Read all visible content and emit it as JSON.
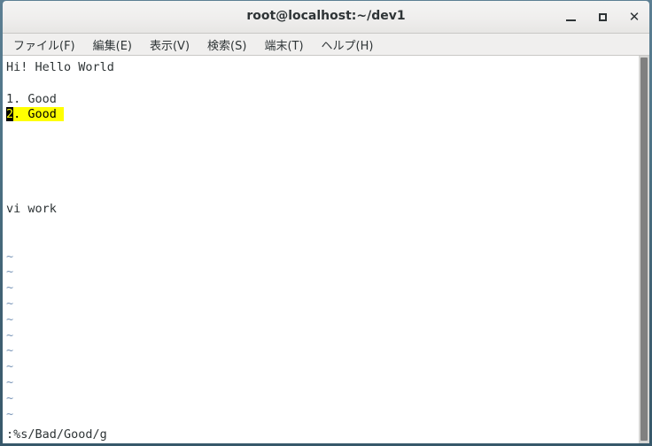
{
  "window": {
    "title": "root@localhost:~/dev1",
    "controls": {
      "minimize": "_",
      "maximize": "□",
      "close": "✕"
    }
  },
  "menubar": {
    "items": [
      {
        "label": "ファイル(F)"
      },
      {
        "label": "編集(E)"
      },
      {
        "label": "表示(V)"
      },
      {
        "label": "検索(S)"
      },
      {
        "label": "端末(T)"
      },
      {
        "label": "ヘルプ(H)"
      }
    ]
  },
  "terminal": {
    "lines": [
      {
        "text": "Hi! Hello World",
        "style": "normal"
      },
      {
        "text": "",
        "style": "normal"
      },
      {
        "text": "1. Good",
        "style": "normal"
      },
      {
        "text": "",
        "style": "highlight"
      },
      {
        "text": "",
        "style": "normal"
      },
      {
        "text": "",
        "style": "normal"
      },
      {
        "text": "",
        "style": "normal"
      },
      {
        "text": "",
        "style": "normal"
      },
      {
        "text": "",
        "style": "normal"
      },
      {
        "text": "vi work",
        "style": "normal"
      },
      {
        "text": "",
        "style": "normal"
      },
      {
        "text": "",
        "style": "normal"
      },
      {
        "text": "~",
        "style": "tilde"
      },
      {
        "text": "~",
        "style": "tilde"
      },
      {
        "text": "~",
        "style": "tilde"
      },
      {
        "text": "~",
        "style": "tilde"
      },
      {
        "text": "~",
        "style": "tilde"
      },
      {
        "text": "~",
        "style": "tilde"
      },
      {
        "text": "~",
        "style": "tilde"
      },
      {
        "text": "~",
        "style": "tilde"
      },
      {
        "text": "~",
        "style": "tilde"
      },
      {
        "text": "~",
        "style": "tilde"
      },
      {
        "text": "~",
        "style": "tilde"
      }
    ],
    "highlighted_line": {
      "cursor_char": "2",
      "rest_text": ". Good "
    },
    "command_line": ":%s/Bad/Good/g",
    "colors": {
      "background": "#ffffff",
      "foreground": "#2e3436",
      "highlight_bg": "#ffff00",
      "cursor_bg": "#000000",
      "tilde_fg": "#7a96b8"
    }
  },
  "scrollbar": {
    "name": "vertical-scrollbar"
  }
}
